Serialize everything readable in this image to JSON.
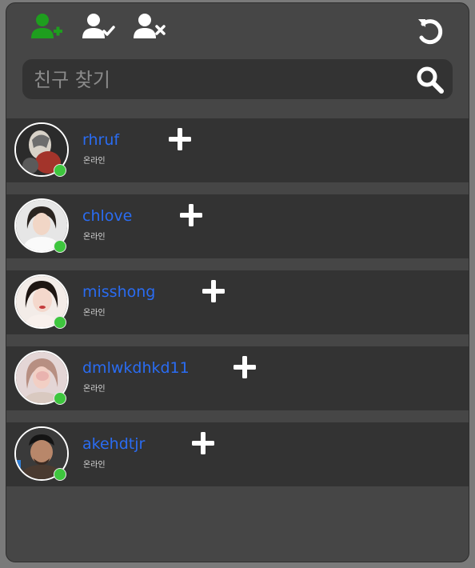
{
  "toolbar": {
    "add_friend_icon": "user-plus-icon",
    "accept_friend_icon": "user-check-icon",
    "remove_friend_icon": "user-times-icon",
    "refresh_icon": "refresh-icon",
    "active_color": "#1e9e1e",
    "inactive_color": "#ffffff"
  },
  "search": {
    "placeholder": "친구 찾기",
    "value": ""
  },
  "friends": [
    {
      "name": "rhruf",
      "status": "온라인",
      "status_color": "#3ec63e"
    },
    {
      "name": "chlove",
      "status": "온라인",
      "status_color": "#3ec63e"
    },
    {
      "name": "misshong",
      "status": "온라인",
      "status_color": "#3ec63e"
    },
    {
      "name": "dmlwkdhkd11",
      "status": "온라인",
      "status_color": "#3ec63e"
    },
    {
      "name": "akehdtjr",
      "status": "온라인",
      "status_color": "#3ec63e"
    }
  ],
  "colors": {
    "panel_bg": "#464646",
    "row_bg": "#333333",
    "name_color": "#2a6cf2"
  }
}
